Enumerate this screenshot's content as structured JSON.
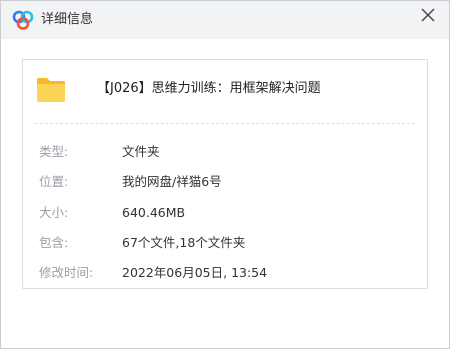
{
  "dialog": {
    "title": "详细信息",
    "close_icon": "close-icon",
    "app_icon": "baidu-netdisk-logo-icon",
    "colors": {
      "logo_blue": "#2f7bf6",
      "logo_cyan": "#25c2e9",
      "logo_red": "#f2513b",
      "folder_yellow": "#f9c53a"
    }
  },
  "file": {
    "icon": "folder-icon",
    "name": "【J026】思维力训练：用框架解决问题"
  },
  "details": {
    "type_label": "类型:",
    "type_value": "文件夹",
    "location_label": "位置:",
    "location_value": "我的网盘/祥猫6号",
    "size_label": "大小:",
    "size_value": "640.46MB",
    "contains_label": "包含:",
    "contains_value": "67个文件,18个文件夹",
    "modified_label": "修改时间:",
    "modified_value": "2022年06月05日, 13:54"
  }
}
